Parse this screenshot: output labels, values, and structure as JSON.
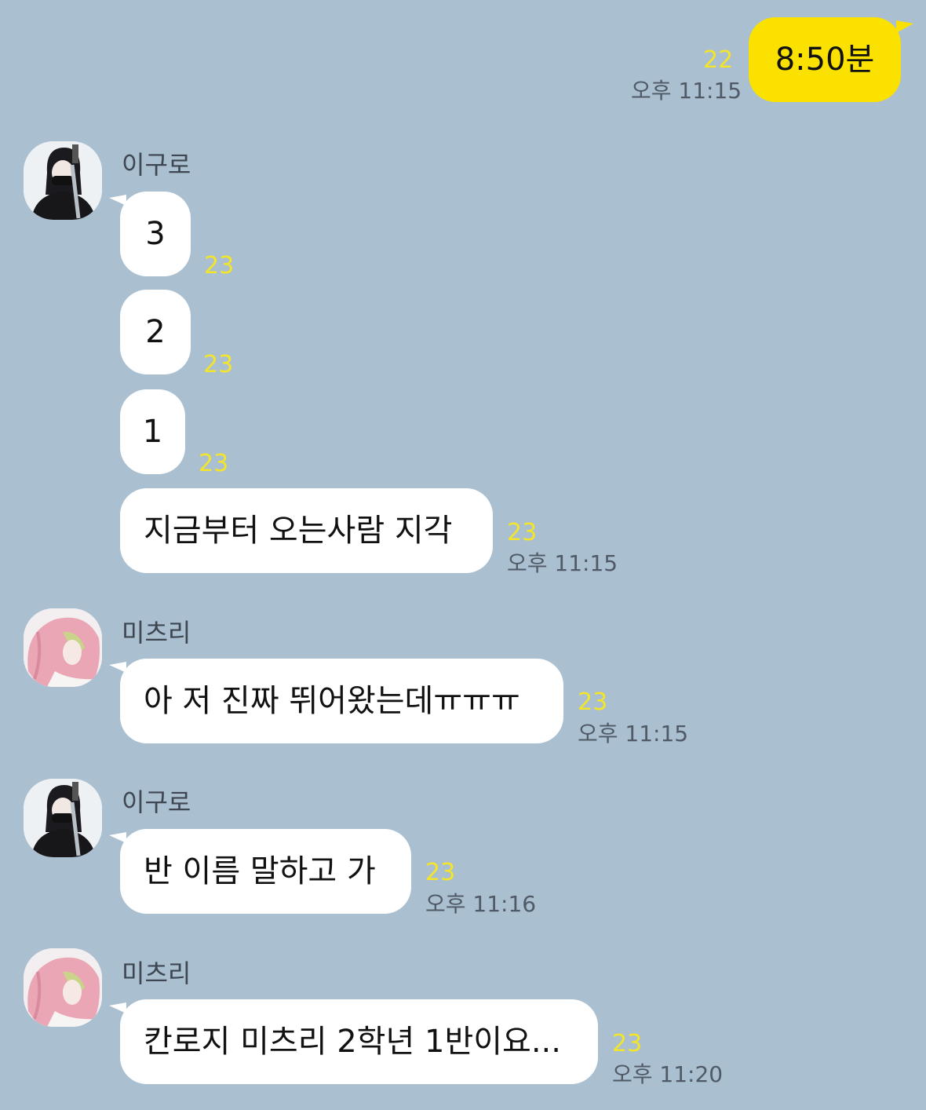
{
  "messages": {
    "m1": {
      "text": "8:50분",
      "unread": "22",
      "time": "오후 11:15"
    },
    "group1": {
      "sender": "이구로",
      "b1": {
        "text": "3",
        "unread": "23"
      },
      "b2": {
        "text": "2",
        "unread": "23"
      },
      "b3": {
        "text": "1",
        "unread": "23"
      },
      "b4": {
        "text": "지금부터 오는사람 지각",
        "unread": "23",
        "time": "오후 11:15"
      }
    },
    "group2": {
      "sender": "미츠리",
      "b1": {
        "text": "아 저 진짜 뛰어왔는데ㅠㅠㅠ",
        "unread": "23",
        "time": "오후 11:15"
      }
    },
    "group3": {
      "sender": "이구로",
      "b1": {
        "text": "반 이름 말하고 가",
        "unread": "23",
        "time": "오후 11:16"
      }
    },
    "group4": {
      "sender": "미츠리",
      "b1": {
        "text": "칸로지 미츠리 2학년 1반이요...",
        "unread": "23",
        "time": "오후 11:20"
      }
    }
  },
  "colors": {
    "background": "#aabfd0",
    "my_bubble": "#fae100",
    "their_bubble": "#ffffff",
    "unread_count": "#f3e52a",
    "timestamp": "#4f5a66"
  },
  "icons": {
    "avatar_iguro": "avatar-dark-hair-masked",
    "avatar_mitsuri": "avatar-pink-hair"
  }
}
